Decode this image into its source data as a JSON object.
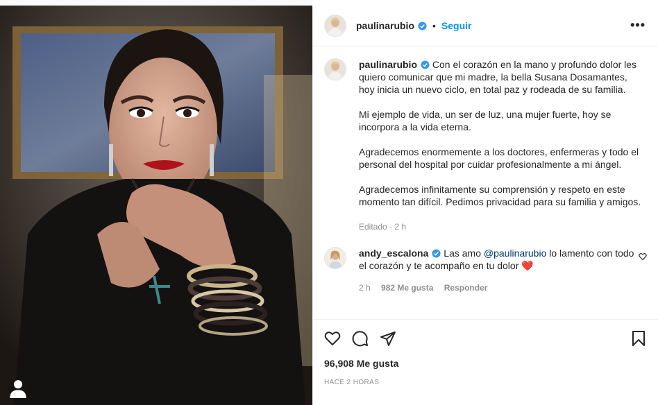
{
  "post": {
    "author": "paulinarubio",
    "follow_label": "Seguir",
    "dot": "•",
    "more_label": "•••",
    "caption_paragraphs": [
      "Con el corazón en la mano y profundo dolor les quiero comunicar que mi madre, la bella Susana Dosamantes, hoy inicia un nuevo ciclo, en total paz y rodeada de su familia.",
      "Mi ejemplo de vida, un ser de luz, una mujer fuerte, hoy se incorpora a la vida eterna.",
      "Agradecemos enormemente a los doctores, enfermeras y todo el personal del hospital por cuidar profesionalmente a mi ángel.",
      "Agradecemos infinitamente su comprensión y respeto en este momento tan difícil. Pedimos privacidad para su familia y amigos."
    ],
    "caption_meta": "Editado · 2 h",
    "likes": "96,908 Me gusta",
    "timestamp": "HACE 2 HORAS"
  },
  "comment": {
    "author": "andy_escalona",
    "text_before": "Las amo ",
    "mention": "@paulinarubio",
    "text_after": " lo lamento con todo el corazón y te acompaño en tu dolor ",
    "emoji": "❤️",
    "time": "2 h",
    "likes": "982 Me gusta",
    "reply_label": "Responder"
  },
  "colors": {
    "accent": "#0095f6",
    "mention": "#00376b",
    "muted": "#8e8e8e",
    "heart": "#ed4956"
  },
  "icons": [
    "like-icon",
    "comment-icon",
    "share-icon",
    "save-icon",
    "verified-icon",
    "tag-user-icon"
  ]
}
